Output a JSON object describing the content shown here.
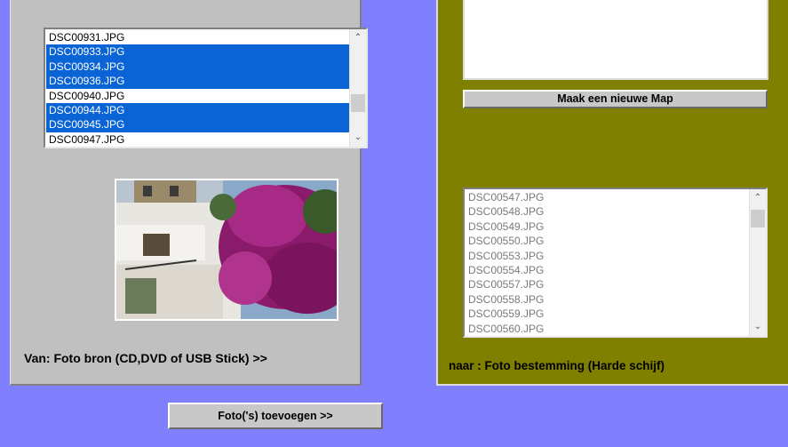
{
  "source": {
    "files": [
      {
        "name": "DSC00931.JPG",
        "selected": false
      },
      {
        "name": "DSC00933.JPG",
        "selected": true
      },
      {
        "name": "DSC00934.JPG",
        "selected": true
      },
      {
        "name": "DSC00936.JPG",
        "selected": true
      },
      {
        "name": "DSC00940.JPG",
        "selected": false
      },
      {
        "name": "DSC00944.JPG",
        "selected": true
      },
      {
        "name": "DSC00945.JPG",
        "selected": true
      },
      {
        "name": "DSC00947.JPG",
        "selected": false
      }
    ],
    "caption": "Van: Foto bron (CD,DVD of USB Stick)  >>"
  },
  "destination": {
    "new_folder_button": "Maak een nieuwe Map",
    "files": [
      "DSC00547.JPG",
      "DSC00548.JPG",
      "DSC00549.JPG",
      "DSC00550.JPG",
      "DSC00553.JPG",
      "DSC00554.JPG",
      "DSC00557.JPG",
      "DSC00558.JPG",
      "DSC00559.JPG",
      "DSC00560.JPG"
    ],
    "caption": "naar :  Foto bestemming (Harde schijf)"
  },
  "actions": {
    "add_photos_button": "Foto('s) toevoegen >>"
  },
  "colors": {
    "background": "#8080ff",
    "left_panel": "#c0c0c0",
    "right_panel": "#808000",
    "selection": "#0a64d6"
  }
}
